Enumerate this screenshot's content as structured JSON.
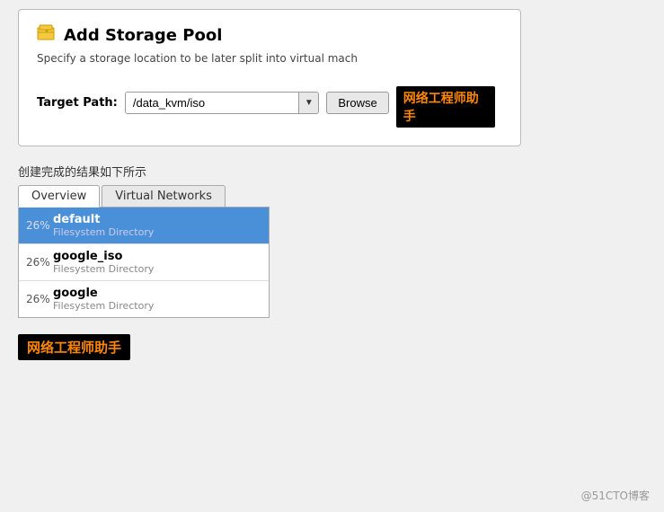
{
  "dialog": {
    "title": "Add Storage Pool",
    "subtitle": "Specify a storage location to be later split into virtual mach",
    "target_path_label": "Target Path:",
    "target_path_value": "/data_kvm/iso",
    "browse_label": "Browse",
    "watermark": "网络工程师助手"
  },
  "result_section": {
    "label": "创建完成的结果如下所示",
    "tabs": [
      {
        "id": "overview",
        "label": "Overview",
        "active": false
      },
      {
        "id": "virtual-networks",
        "label": "Virtual Networks",
        "active": false
      }
    ],
    "pools": [
      {
        "percent": "26%",
        "name": "default",
        "type": "Filesystem Directory",
        "selected": true
      },
      {
        "percent": "26%",
        "name": "google_iso",
        "type": "Filesystem Directory",
        "selected": false
      },
      {
        "percent": "26%",
        "name": "google",
        "type": "Filesystem Directory",
        "selected": false
      }
    ],
    "watermark": "网络工程师助手"
  },
  "footer": {
    "text": "@51CTO博客"
  }
}
